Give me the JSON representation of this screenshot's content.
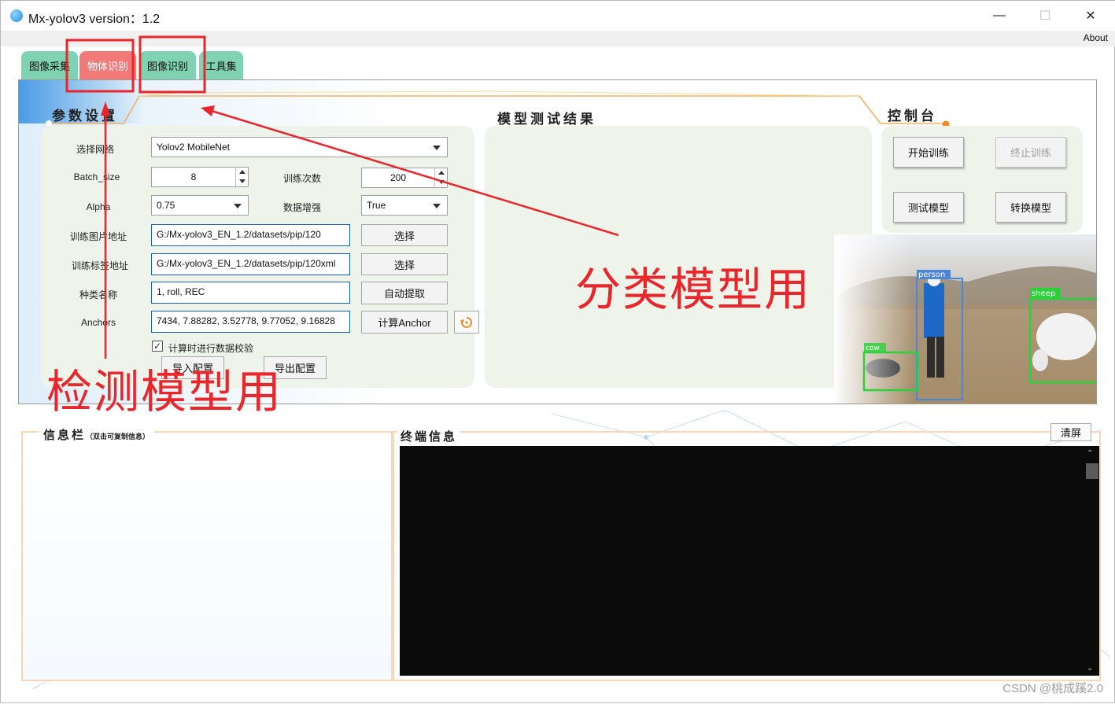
{
  "window": {
    "title": "Mx-yolov3 version：1.2",
    "minimize": "—",
    "maximize": "☐",
    "close": "✕"
  },
  "menu": {
    "about": "About"
  },
  "tabs": [
    {
      "label": "图像采集"
    },
    {
      "label": "物体识别",
      "active": true
    },
    {
      "label": "图像识别"
    },
    {
      "label": "工具集"
    }
  ],
  "params": {
    "section_title": "参数设置",
    "network": {
      "label": "选择网络",
      "value": "Yolov2 MobileNet"
    },
    "batch_size": {
      "label": "Batch_size",
      "value": "8"
    },
    "epochs": {
      "label": "训练次数",
      "value": "200"
    },
    "alpha": {
      "label": "Alpha",
      "value": "0.75"
    },
    "augment": {
      "label": "数据增强",
      "value": "True"
    },
    "train_images": {
      "label": "训练图片地址",
      "value": "G:/Mx-yolov3_EN_1.2/datasets/pip/120",
      "button": "选择"
    },
    "train_labels": {
      "label": "训练标签地址",
      "value": "G:/Mx-yolov3_EN_1.2/datasets/pip/120xml",
      "button": "选择"
    },
    "class_names": {
      "label": "种类名称",
      "value": "1, roll, REC",
      "button": "自动提取"
    },
    "anchors": {
      "label": "Anchors",
      "value": "7434, 7.88282, 3.52778, 9.77052, 9.16828",
      "button": "计算Anchor"
    },
    "check_data": {
      "label": "计算时进行数据校验",
      "checked": true
    },
    "import_config": "导入配置",
    "export_config": "导出配置"
  },
  "model_result": {
    "title": "模型测试结果"
  },
  "console": {
    "title": "控制台",
    "start_train": "开始训练",
    "stop_train": "终止训练",
    "test_model": "测试模型",
    "convert_model": "转换模型",
    "detections": [
      {
        "label": "person",
        "color": "#4a86d8"
      },
      {
        "label": "sheep",
        "color": "#2bd13a"
      },
      {
        "label": "cow",
        "color": "#2bd13a"
      }
    ]
  },
  "info_bar": {
    "title": "信息栏",
    "subtitle": "（双击可复制信息）"
  },
  "terminal": {
    "title": "终端信息",
    "clear": "清屏"
  },
  "annotations": {
    "classify": "分类模型用",
    "detect": "检测模型用"
  },
  "watermark": "CSDN @桃成蹊2.0",
  "colors": {
    "tab_active": "#f17a79",
    "tab": "#7fd3b3",
    "accent_orange": "#f08a24",
    "annotation_red": "#e8262b"
  }
}
